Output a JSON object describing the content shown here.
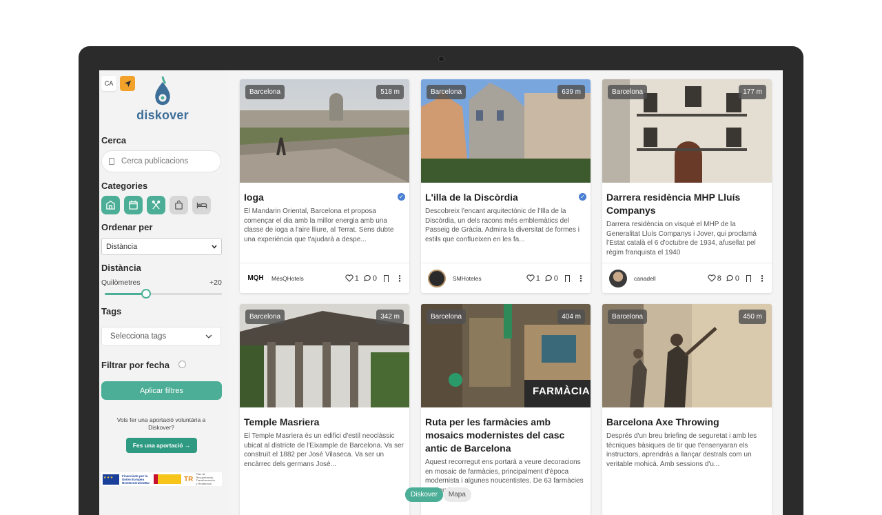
{
  "sidebar": {
    "lang": "CA",
    "logo_text": "diskover",
    "search_title": "Cerca",
    "search_placeholder": "Cerca publicacions",
    "categories_title": "Categories",
    "categories": [
      {
        "icon": "building-icon",
        "active": true
      },
      {
        "icon": "calendar-icon",
        "active": true
      },
      {
        "icon": "utensils-icon",
        "active": true
      },
      {
        "icon": "shopping-bag-icon",
        "active": false
      },
      {
        "icon": "bed-icon",
        "active": false
      }
    ],
    "order_title": "Ordenar per",
    "order_value": "Distància",
    "distance_title": "Distància",
    "km_label": "Quilòmetres",
    "km_max": "+20",
    "km_value_fraction": 0.35,
    "tags_title": "Tags",
    "tags_placeholder": "Selecciona tags",
    "date_filter": "Filtrar por fecha",
    "apply": "Aplicar filtres",
    "donate_text": "Vols fer una aportació voluntària a Diskover?",
    "donate_btn": "Fes una aportació →",
    "funding_eu": "Financiado por la Unión Europea NextGenerationEU",
    "funding_plan": "Plan de Recuperación, Transformación y Resiliencia"
  },
  "colors": {
    "accent": "#4cae96",
    "orange": "#f2a22b",
    "brand_blue": "#3d6e98"
  },
  "cards": [
    {
      "city": "Barcelona",
      "distance": "518 m",
      "title": "Ioga",
      "verified": true,
      "desc": "El Mandarin Oriental, Barcelona et proposa començar el dia amb la millor energia amb una classe de ioga a l'aire lliure, al Terrat. Sens dubte una experiència que t'ajudarà a despe...",
      "author": "MésQHotels",
      "likes": "1",
      "comments": "0"
    },
    {
      "city": "Barcelona",
      "distance": "639 m",
      "title": "L'illa de la Discòrdia",
      "verified": true,
      "desc": "Descobreix l'encant arquitectònic de l'Illa de la Discòrdia, un dels racons més emblemàtics del Passeig de Gràcia. Admira la diversitat de formes i estils que conflueixen en les fa...",
      "author": "SMHoteles",
      "likes": "1",
      "comments": "0"
    },
    {
      "city": "Barcelona",
      "distance": "177 m",
      "title": "Darrera residència MHP Lluís Companys",
      "verified": false,
      "desc": "Darrera residència on visquè el MHP de la Generalitat Lluís Companys i Jover, qui proclamà l'Estat català el 6 d'octubre de 1934, afusellat pel règim franquista el 1940",
      "author": "canadell",
      "likes": "8",
      "comments": "0"
    },
    {
      "city": "Barcelona",
      "distance": "342 m",
      "title": "Temple Masriera",
      "verified": false,
      "desc": "El Temple Masriera és un edifici d'estil neoclàssic ubicat al districte de l'Eixample de Barcelona. Va ser construït el 1882 per José Vilaseca. Va ser un encàrrec dels germans José..."
    },
    {
      "city": "Barcelona",
      "distance": "404 m",
      "title": "Ruta per les farmàcies amb mosaics modernistes del casc antic de Barcelona",
      "verified": false,
      "desc": "Aquest recorregut ens portarà a veure decoracions en mosaic de farmàcies, principalment d'època modernista i algunes noucentistes. De 63 farmàcies modernistes",
      "sign": "FARMÀCIA"
    },
    {
      "city": "Barcelona",
      "distance": "450 m",
      "title": "Barcelona Axe Throwing",
      "verified": false,
      "desc": "Després d'un breu briefing de seguretat i amb les tècniques bàsiques de tir que t'ensenyaran els instructors, aprendràs a llançar destrals com un veritable mohicà. Amb sessions d'u..."
    }
  ],
  "bottom_tabs": [
    "Diskover",
    "Mapa"
  ]
}
